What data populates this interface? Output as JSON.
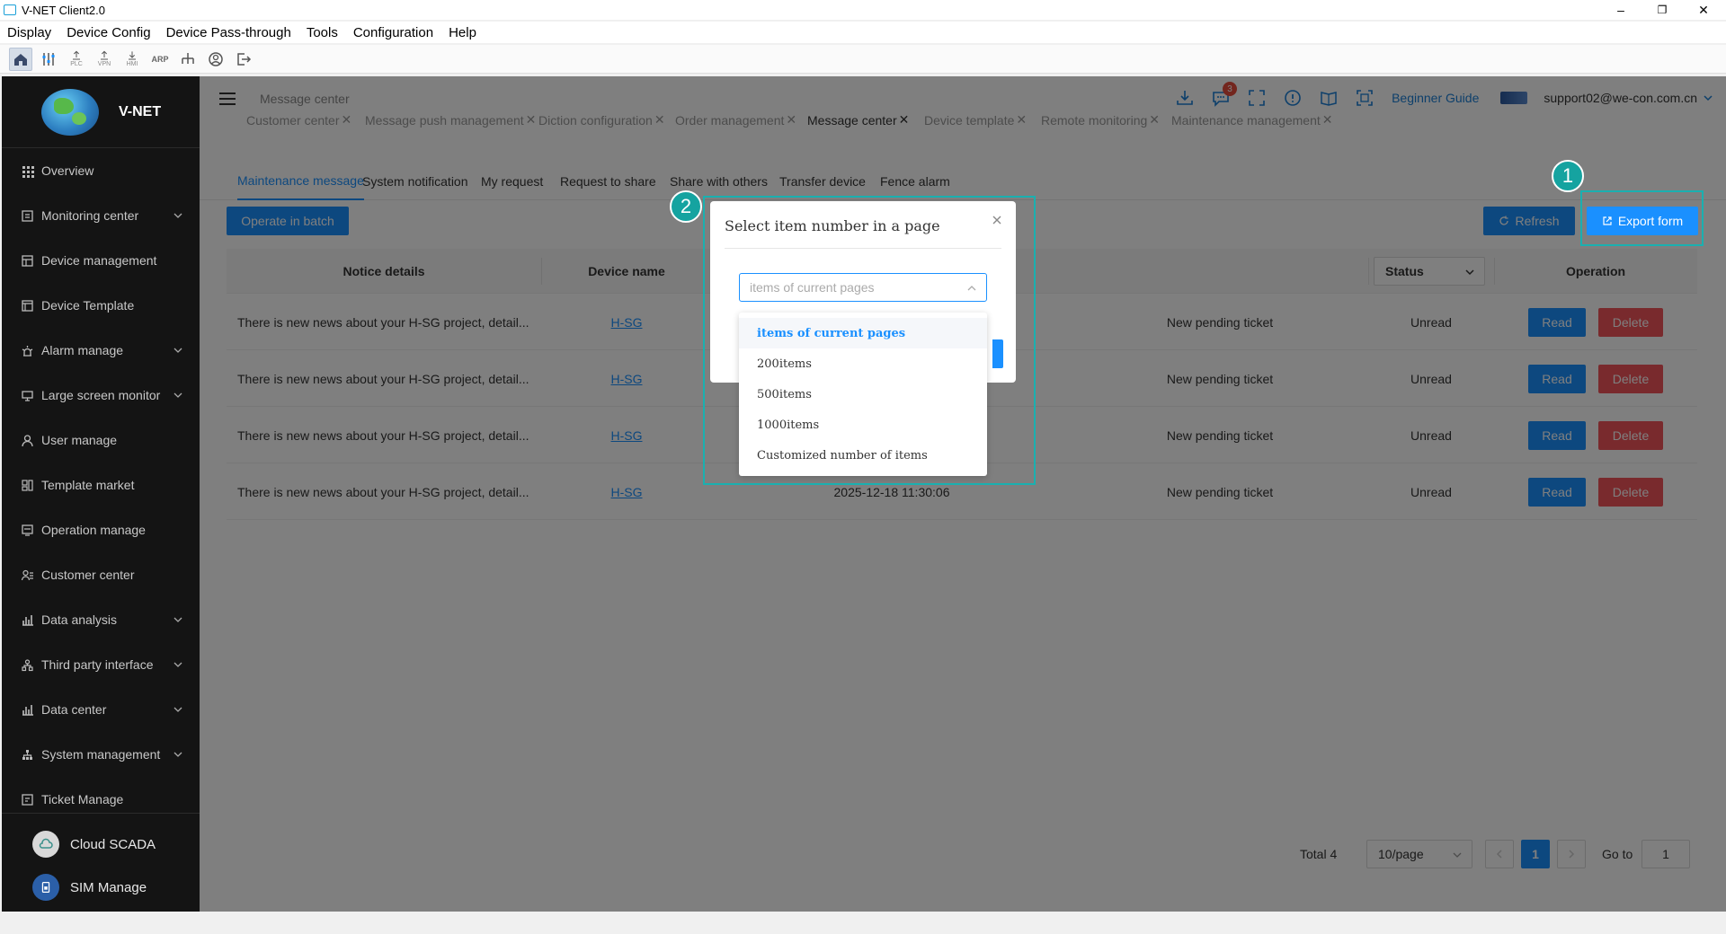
{
  "window": {
    "title": "V-NET Client2.0",
    "minimize": "–",
    "maximize": "❐",
    "close": "✕"
  },
  "menubar": [
    "Display",
    "Device Config",
    "Device Pass-through",
    "Tools",
    "Configuration",
    "Help"
  ],
  "toolbar": {
    "labels": [
      "PLC",
      "VPN",
      "HMI",
      "ARP"
    ]
  },
  "sidebar": {
    "logo_text": "V-NET",
    "items": [
      {
        "label": "Overview",
        "icon": "grid-icon",
        "expandable": false
      },
      {
        "label": "Monitoring center",
        "icon": "monitor-icon",
        "expandable": true
      },
      {
        "label": "Device management",
        "icon": "device-icon",
        "expandable": false
      },
      {
        "label": "Device Template",
        "icon": "template-icon",
        "expandable": false
      },
      {
        "label": "Alarm manage",
        "icon": "alarm-icon",
        "expandable": true
      },
      {
        "label": "Large screen monitor",
        "icon": "screen-icon",
        "expandable": true
      },
      {
        "label": "User manage",
        "icon": "user-icon",
        "expandable": false
      },
      {
        "label": "Template market",
        "icon": "market-icon",
        "expandable": false
      },
      {
        "label": "Operation manage",
        "icon": "operation-icon",
        "expandable": false
      },
      {
        "label": "Customer center",
        "icon": "customer-icon",
        "expandable": false
      },
      {
        "label": "Data analysis",
        "icon": "chart-icon",
        "expandable": true
      },
      {
        "label": "Third party interface",
        "icon": "interface-icon",
        "expandable": true
      },
      {
        "label": "Data center",
        "icon": "datacenter-icon",
        "expandable": true
      },
      {
        "label": "System management",
        "icon": "system-icon",
        "expandable": true
      },
      {
        "label": "Ticket Manage",
        "icon": "ticket-icon",
        "expandable": false
      }
    ],
    "bottom": [
      {
        "label": "Cloud SCADA",
        "icon": "cloud-icon"
      },
      {
        "label": "SIM Manage",
        "icon": "sim-icon"
      }
    ]
  },
  "header": {
    "breadcrumb": "Message center",
    "message_badge": "3",
    "beginner_guide": "Beginner Guide",
    "user_email": "support02@we-con.com.cn"
  },
  "tabs": [
    {
      "label": "Customer center",
      "active": false
    },
    {
      "label": "Message push management",
      "active": false
    },
    {
      "label": "Diction configuration",
      "active": false
    },
    {
      "label": "Order management",
      "active": false
    },
    {
      "label": "Message center",
      "active": true
    },
    {
      "label": "Device template",
      "active": false
    },
    {
      "label": "Remote monitoring",
      "active": false
    },
    {
      "label": "Maintenance management",
      "active": false
    }
  ],
  "subtabs": [
    {
      "label": "Maintenance message",
      "active": true
    },
    {
      "label": "System notification",
      "active": false
    },
    {
      "label": "My request",
      "active": false
    },
    {
      "label": "Request to share",
      "active": false
    },
    {
      "label": "Share with others",
      "active": false
    },
    {
      "label": "Transfer device",
      "active": false
    },
    {
      "label": "Fence alarm",
      "active": false
    }
  ],
  "actions": {
    "batch": "Operate in batch",
    "refresh": "Refresh",
    "export": "Export form"
  },
  "table": {
    "headers": {
      "notice": "Notice details",
      "device": "Device name",
      "status": "Status",
      "operation": "Operation"
    },
    "rows": [
      {
        "notice": "There is new news about your H-SG project, detail...",
        "device": "H-SG",
        "time": "",
        "type": "New pending ticket",
        "status": "Unread"
      },
      {
        "notice": "There is new news about your H-SG project, detail...",
        "device": "H-SG",
        "time": "",
        "type": "New pending ticket",
        "status": "Unread"
      },
      {
        "notice": "There is new news about your H-SG project, detail...",
        "device": "H-SG",
        "time": "",
        "type": "New pending ticket",
        "status": "Unread"
      },
      {
        "notice": "There is new news about your H-SG project, detail...",
        "device": "H-SG",
        "time": "2025-12-18 11:30:06",
        "type": "New pending ticket",
        "status": "Unread"
      }
    ],
    "read_label": "Read",
    "delete_label": "Delete"
  },
  "pagination": {
    "total": "Total 4",
    "page_size": "10/page",
    "current": "1",
    "goto_label": "Go to",
    "goto_value": "1"
  },
  "dialog": {
    "title": "Select item number in a page",
    "placeholder": "items of current pages",
    "options": [
      "items of current pages",
      "200items",
      "500items",
      "1000items",
      "Customized number of items"
    ],
    "selected_index": 0
  },
  "markers": {
    "export": "1",
    "dialog": "2"
  },
  "colors": {
    "accent": "#1a90ff",
    "danger": "#f2545b",
    "highlight": "#15a3a0",
    "sidebar": "#141414"
  }
}
